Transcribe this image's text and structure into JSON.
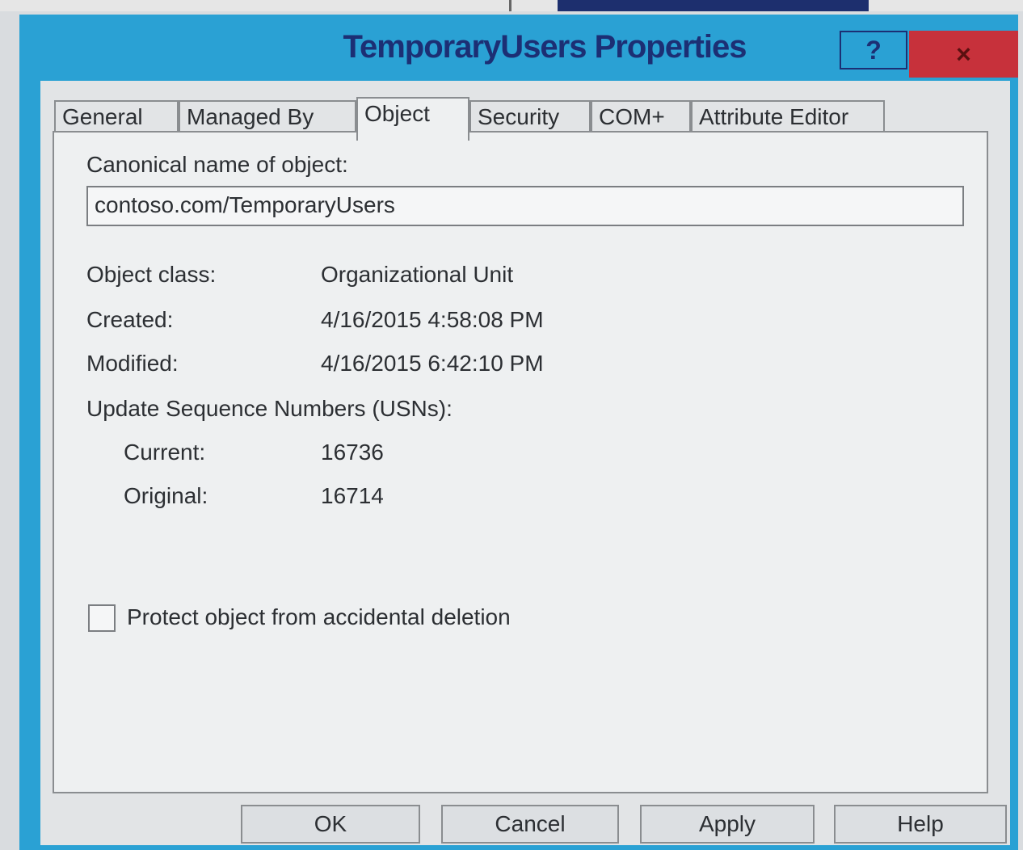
{
  "window": {
    "title": "TemporaryUsers Properties",
    "help_button": "?",
    "close_button": "×"
  },
  "tabs": [
    {
      "label": "General"
    },
    {
      "label": "Managed By"
    },
    {
      "label": "Object"
    },
    {
      "label": "Security"
    },
    {
      "label": "COM+"
    },
    {
      "label": "Attribute Editor"
    }
  ],
  "active_tab": "Object",
  "object": {
    "canonical_label": "Canonical name of object:",
    "canonical_value": "contoso.com/TemporaryUsers",
    "class_label": "Object class:",
    "class_value": "Organizational Unit",
    "created_label": "Created:",
    "created_value": "4/16/2015 4:58:08 PM",
    "modified_label": "Modified:",
    "modified_value": "4/16/2015 6:42:10 PM",
    "usn_label": "Update Sequence Numbers (USNs):",
    "current_label": "Current:",
    "current_value": "16736",
    "original_label": "Original:",
    "original_value": "16714",
    "protect_label": "Protect object from accidental deletion",
    "protect_checked": false
  },
  "buttons": {
    "ok": "OK",
    "cancel": "Cancel",
    "apply": "Apply",
    "help": "Help"
  }
}
